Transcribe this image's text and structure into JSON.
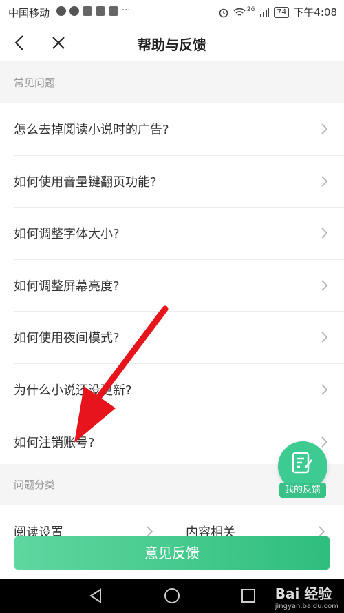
{
  "status_bar": {
    "carrier": "中国移动",
    "network": "26",
    "battery": "74",
    "time": "下午4:08"
  },
  "nav": {
    "title": "帮助与反馈",
    "back_icon": "chevron-left-icon",
    "close_icon": "close-icon"
  },
  "faq": {
    "header": "常见问题",
    "items": [
      {
        "label": "怎么去掉阅读小说时的广告?"
      },
      {
        "label": "如何使用音量键翻页功能?"
      },
      {
        "label": "如何调整字体大小?"
      },
      {
        "label": "如何调整屏幕亮度?"
      },
      {
        "label": "如何使用夜间模式?"
      },
      {
        "label": "为什么小说还没更新?"
      },
      {
        "label": "如何注销账号?"
      }
    ]
  },
  "categories": {
    "header": "问题分类",
    "items": [
      {
        "label": "阅读设置"
      },
      {
        "label": "内容相关"
      }
    ]
  },
  "fab": {
    "label": "我的反馈",
    "icon": "edit-note-icon"
  },
  "feedback_button": {
    "label": "意见反馈"
  },
  "watermark": {
    "brand": "Bai 经验",
    "url": "jingyan.baidu.com"
  },
  "colors": {
    "accent": "#3ecb92",
    "annotation_arrow": "#e8141c"
  }
}
